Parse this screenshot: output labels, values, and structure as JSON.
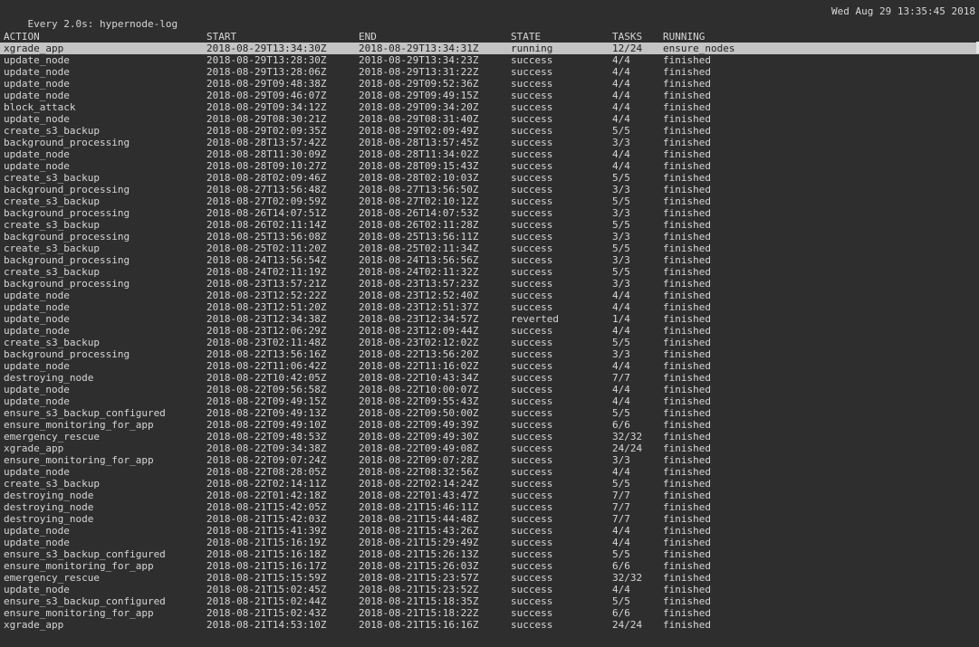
{
  "terminal": {
    "watch_header": "Every 2.0s: hypernode-log",
    "clock": "Wed Aug 29 13:35:45 2018"
  },
  "columns": [
    "ACTION",
    "START",
    "END",
    "STATE",
    "TASKS",
    "RUNNING"
  ],
  "rows": [
    [
      "xgrade_app",
      "2018-08-29T13:34:30Z",
      "2018-08-29T13:34:31Z",
      "running",
      "12/24",
      "ensure_nodes"
    ],
    [
      "update_node",
      "2018-08-29T13:28:30Z",
      "2018-08-29T13:34:23Z",
      "success",
      "4/4",
      "finished"
    ],
    [
      "update_node",
      "2018-08-29T13:28:06Z",
      "2018-08-29T13:31:22Z",
      "success",
      "4/4",
      "finished"
    ],
    [
      "update_node",
      "2018-08-29T09:48:38Z",
      "2018-08-29T09:52:36Z",
      "success",
      "4/4",
      "finished"
    ],
    [
      "update_node",
      "2018-08-29T09:46:07Z",
      "2018-08-29T09:49:15Z",
      "success",
      "4/4",
      "finished"
    ],
    [
      "block_attack",
      "2018-08-29T09:34:12Z",
      "2018-08-29T09:34:20Z",
      "success",
      "4/4",
      "finished"
    ],
    [
      "update_node",
      "2018-08-29T08:30:21Z",
      "2018-08-29T08:31:40Z",
      "success",
      "4/4",
      "finished"
    ],
    [
      "create_s3_backup",
      "2018-08-29T02:09:35Z",
      "2018-08-29T02:09:49Z",
      "success",
      "5/5",
      "finished"
    ],
    [
      "background_processing",
      "2018-08-28T13:57:42Z",
      "2018-08-28T13:57:45Z",
      "success",
      "3/3",
      "finished"
    ],
    [
      "update_node",
      "2018-08-28T11:30:09Z",
      "2018-08-28T11:34:02Z",
      "success",
      "4/4",
      "finished"
    ],
    [
      "update_node",
      "2018-08-28T09:10:27Z",
      "2018-08-28T09:15:43Z",
      "success",
      "4/4",
      "finished"
    ],
    [
      "create_s3_backup",
      "2018-08-28T02:09:46Z",
      "2018-08-28T02:10:03Z",
      "success",
      "5/5",
      "finished"
    ],
    [
      "background_processing",
      "2018-08-27T13:56:48Z",
      "2018-08-27T13:56:50Z",
      "success",
      "3/3",
      "finished"
    ],
    [
      "create_s3_backup",
      "2018-08-27T02:09:59Z",
      "2018-08-27T02:10:12Z",
      "success",
      "5/5",
      "finished"
    ],
    [
      "background_processing",
      "2018-08-26T14:07:51Z",
      "2018-08-26T14:07:53Z",
      "success",
      "3/3",
      "finished"
    ],
    [
      "create_s3_backup",
      "2018-08-26T02:11:14Z",
      "2018-08-26T02:11:28Z",
      "success",
      "5/5",
      "finished"
    ],
    [
      "background_processing",
      "2018-08-25T13:56:08Z",
      "2018-08-25T13:56:11Z",
      "success",
      "3/3",
      "finished"
    ],
    [
      "create_s3_backup",
      "2018-08-25T02:11:20Z",
      "2018-08-25T02:11:34Z",
      "success",
      "5/5",
      "finished"
    ],
    [
      "background_processing",
      "2018-08-24T13:56:54Z",
      "2018-08-24T13:56:56Z",
      "success",
      "3/3",
      "finished"
    ],
    [
      "create_s3_backup",
      "2018-08-24T02:11:19Z",
      "2018-08-24T02:11:32Z",
      "success",
      "5/5",
      "finished"
    ],
    [
      "background_processing",
      "2018-08-23T13:57:21Z",
      "2018-08-23T13:57:23Z",
      "success",
      "3/3",
      "finished"
    ],
    [
      "update_node",
      "2018-08-23T12:52:22Z",
      "2018-08-23T12:52:40Z",
      "success",
      "4/4",
      "finished"
    ],
    [
      "update_node",
      "2018-08-23T12:51:20Z",
      "2018-08-23T12:51:37Z",
      "success",
      "4/4",
      "finished"
    ],
    [
      "update_node",
      "2018-08-23T12:34:38Z",
      "2018-08-23T12:34:57Z",
      "reverted",
      "1/4",
      "finished"
    ],
    [
      "update_node",
      "2018-08-23T12:06:29Z",
      "2018-08-23T12:09:44Z",
      "success",
      "4/4",
      "finished"
    ],
    [
      "create_s3_backup",
      "2018-08-23T02:11:48Z",
      "2018-08-23T02:12:02Z",
      "success",
      "5/5",
      "finished"
    ],
    [
      "background_processing",
      "2018-08-22T13:56:16Z",
      "2018-08-22T13:56:20Z",
      "success",
      "3/3",
      "finished"
    ],
    [
      "update_node",
      "2018-08-22T11:06:42Z",
      "2018-08-22T11:16:02Z",
      "success",
      "4/4",
      "finished"
    ],
    [
      "destroying_node",
      "2018-08-22T10:42:05Z",
      "2018-08-22T10:43:34Z",
      "success",
      "7/7",
      "finished"
    ],
    [
      "update_node",
      "2018-08-22T09:56:58Z",
      "2018-08-22T10:00:07Z",
      "success",
      "4/4",
      "finished"
    ],
    [
      "update_node",
      "2018-08-22T09:49:15Z",
      "2018-08-22T09:55:43Z",
      "success",
      "4/4",
      "finished"
    ],
    [
      "ensure_s3_backup_configured",
      "2018-08-22T09:49:13Z",
      "2018-08-22T09:50:00Z",
      "success",
      "5/5",
      "finished"
    ],
    [
      "ensure_monitoring_for_app",
      "2018-08-22T09:49:10Z",
      "2018-08-22T09:49:39Z",
      "success",
      "6/6",
      "finished"
    ],
    [
      "emergency_rescue",
      "2018-08-22T09:48:53Z",
      "2018-08-22T09:49:30Z",
      "success",
      "32/32",
      "finished"
    ],
    [
      "xgrade_app",
      "2018-08-22T09:34:38Z",
      "2018-08-22T09:49:08Z",
      "success",
      "24/24",
      "finished"
    ],
    [
      "ensure_monitoring_for_app",
      "2018-08-22T09:07:24Z",
      "2018-08-22T09:07:28Z",
      "success",
      "3/3",
      "finished"
    ],
    [
      "update_node",
      "2018-08-22T08:28:05Z",
      "2018-08-22T08:32:56Z",
      "success",
      "4/4",
      "finished"
    ],
    [
      "create_s3_backup",
      "2018-08-22T02:14:11Z",
      "2018-08-22T02:14:24Z",
      "success",
      "5/5",
      "finished"
    ],
    [
      "destroying_node",
      "2018-08-22T01:42:18Z",
      "2018-08-22T01:43:47Z",
      "success",
      "7/7",
      "finished"
    ],
    [
      "destroying_node",
      "2018-08-21T15:42:05Z",
      "2018-08-21T15:46:11Z",
      "success",
      "7/7",
      "finished"
    ],
    [
      "destroying_node",
      "2018-08-21T15:42:03Z",
      "2018-08-21T15:44:48Z",
      "success",
      "7/7",
      "finished"
    ],
    [
      "update_node",
      "2018-08-21T15:41:39Z",
      "2018-08-21T15:43:26Z",
      "success",
      "4/4",
      "finished"
    ],
    [
      "update_node",
      "2018-08-21T15:16:19Z",
      "2018-08-21T15:29:49Z",
      "success",
      "4/4",
      "finished"
    ],
    [
      "ensure_s3_backup_configured",
      "2018-08-21T15:16:18Z",
      "2018-08-21T15:26:13Z",
      "success",
      "5/5",
      "finished"
    ],
    [
      "ensure_monitoring_for_app",
      "2018-08-21T15:16:17Z",
      "2018-08-21T15:26:03Z",
      "success",
      "6/6",
      "finished"
    ],
    [
      "emergency_rescue",
      "2018-08-21T15:15:59Z",
      "2018-08-21T15:23:57Z",
      "success",
      "32/32",
      "finished"
    ],
    [
      "update_node",
      "2018-08-21T15:02:45Z",
      "2018-08-21T15:23:52Z",
      "success",
      "4/4",
      "finished"
    ],
    [
      "ensure_s3_backup_configured",
      "2018-08-21T15:02:44Z",
      "2018-08-21T15:18:35Z",
      "success",
      "5/5",
      "finished"
    ],
    [
      "ensure_monitoring_for_app",
      "2018-08-21T15:02:43Z",
      "2018-08-21T15:18:22Z",
      "success",
      "6/6",
      "finished"
    ],
    [
      "xgrade_app",
      "2018-08-21T14:53:10Z",
      "2018-08-21T15:16:16Z",
      "success",
      "24/24",
      "finished"
    ]
  ],
  "colors": {
    "background": "#2e2e2e",
    "text": "#d6d6d6",
    "highlight_row_bg": "#c4c4c4",
    "highlight_row_text": "#1e1e1e"
  }
}
